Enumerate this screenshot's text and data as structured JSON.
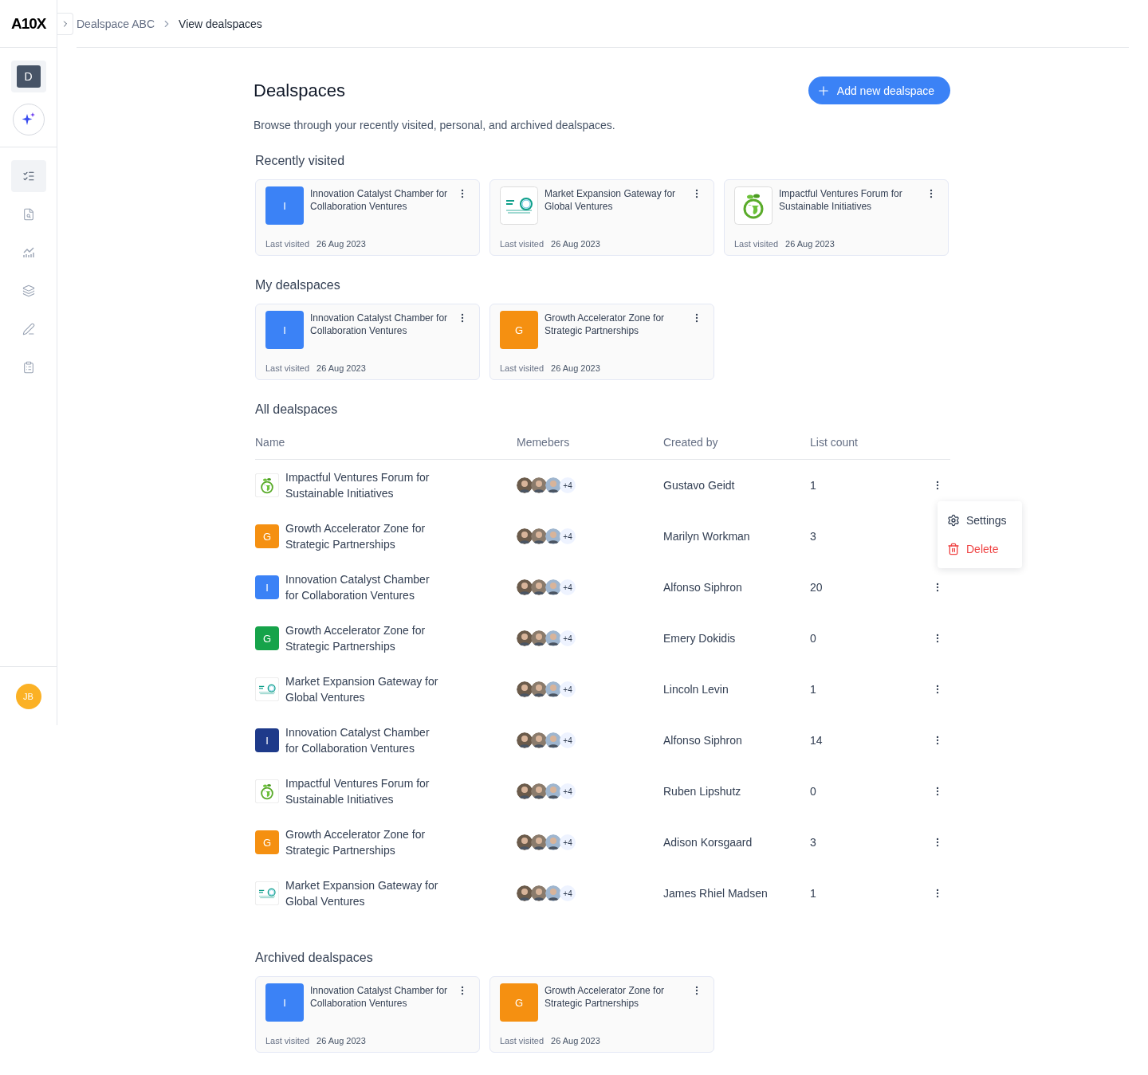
{
  "brand": {
    "logo": "A10X"
  },
  "breadcrumb": [
    {
      "label": "Dealspace ABC",
      "current": false
    },
    {
      "label": "View dealspaces",
      "current": true
    }
  ],
  "sidebar": {
    "workspace": "D",
    "nav": [
      {
        "selected": true
      },
      {
        "selected": false
      },
      {
        "selected": false
      },
      {
        "selected": false
      },
      {
        "selected": false
      },
      {
        "selected": false
      }
    ],
    "user": "JB"
  },
  "page": {
    "title": "Dealspaces",
    "subtitle": "Browse through your recently visited, personal, and archived dealspaces.",
    "add_button": "Add new dealspace"
  },
  "sections": [
    {
      "title": "Recently visited",
      "cards": [
        {
          "name": "Innovation Catalyst Chamber for Collaboration Ventures",
          "logo": {
            "kind": "letter",
            "letter": "I",
            "color": "#3b82f6"
          },
          "label": "Last visited",
          "date": "26 Aug 2023"
        },
        {
          "name": "Market Expansion Gateway for Global Ventures",
          "logo": {
            "kind": "rings"
          },
          "label": "Last visited",
          "date": "26 Aug 2023"
        },
        {
          "name": "Impactful Ventures Forum for Sustainable Initiatives",
          "logo": {
            "kind": "globe"
          },
          "label": "Last visited",
          "date": "26 Aug 2023"
        }
      ]
    },
    {
      "title": "My dealspaces",
      "cards": [
        {
          "name": "Innovation Catalyst Chamber for Collaboration Ventures",
          "logo": {
            "kind": "letter",
            "letter": "I",
            "color": "#3b82f6"
          },
          "label": "Last visited",
          "date": "26 Aug 2023"
        },
        {
          "name": "Growth Accelerator Zone for Strategic Partnerships",
          "logo": {
            "kind": "letter",
            "letter": "G",
            "color": "#f59011"
          },
          "label": "Last visited",
          "date": "26 Aug 2023"
        }
      ]
    }
  ],
  "all": {
    "title": "All dealspaces",
    "columns": [
      "Name",
      "Memebers",
      "Created by",
      "List count"
    ],
    "rows": [
      {
        "name": "Impactful Ventures Forum for Sustainable Initiatives",
        "logo": {
          "kind": "globe"
        },
        "more": "+4",
        "created_by": "Gustavo Geidt",
        "count": "1"
      },
      {
        "name": "Growth Accelerator Zone for Strategic Partnerships",
        "logo": {
          "kind": "letter",
          "letter": "G",
          "color": "#f59011"
        },
        "more": "+4",
        "created_by": "Marilyn Workman",
        "count": "3"
      },
      {
        "name": "Innovation Catalyst Chamber for Collaboration Ventures",
        "logo": {
          "kind": "letter",
          "letter": "I",
          "color": "#3b82f6"
        },
        "more": "+4",
        "created_by": "Alfonso Siphron",
        "count": "20"
      },
      {
        "name": "Growth Accelerator Zone for Strategic Partnerships",
        "logo": {
          "kind": "letter",
          "letter": "G",
          "color": "#16a34a"
        },
        "more": "+4",
        "created_by": "Emery Dokidis",
        "count": "0"
      },
      {
        "name": "Market Expansion Gateway for Global Ventures",
        "logo": {
          "kind": "rings"
        },
        "more": "+4",
        "created_by": "Lincoln Levin",
        "count": "1"
      },
      {
        "name": "Innovation Catalyst Chamber for Collaboration Ventures",
        "logo": {
          "kind": "letter",
          "letter": "I",
          "color": "#1e3a8a"
        },
        "more": "+4",
        "created_by": "Alfonso Siphron",
        "count": "14"
      },
      {
        "name": "Impactful Ventures Forum for Sustainable Initiatives",
        "logo": {
          "kind": "globe"
        },
        "more": "+4",
        "created_by": "Ruben Lipshutz",
        "count": "0"
      },
      {
        "name": "Growth Accelerator Zone for Strategic Partnerships",
        "logo": {
          "kind": "letter",
          "letter": "G",
          "color": "#f59011"
        },
        "more": "+4",
        "created_by": "Adison Korsgaard",
        "count": "3"
      },
      {
        "name": "Market Expansion Gateway for Global Ventures",
        "logo": {
          "kind": "rings"
        },
        "more": "+4",
        "created_by": "James Rhiel Madsen",
        "count": "1"
      }
    ],
    "menu": {
      "open": true,
      "items": [
        {
          "kind": "settings",
          "label": "Settings"
        },
        {
          "kind": "delete",
          "label": "Delete"
        }
      ]
    }
  },
  "archived": {
    "title": "Archived dealspaces",
    "cards": [
      {
        "name": "Innovation Catalyst Chamber for Collaboration Ventures",
        "logo": {
          "kind": "letter",
          "letter": "I",
          "color": "#3b82f6"
        },
        "label": "Last visited",
        "date": "26 Aug 2023"
      },
      {
        "name": "Growth Accelerator Zone for Strategic Partnerships",
        "logo": {
          "kind": "letter",
          "letter": "G",
          "color": "#f59011"
        },
        "label": "Last visited",
        "date": "26 Aug 2023"
      }
    ]
  }
}
